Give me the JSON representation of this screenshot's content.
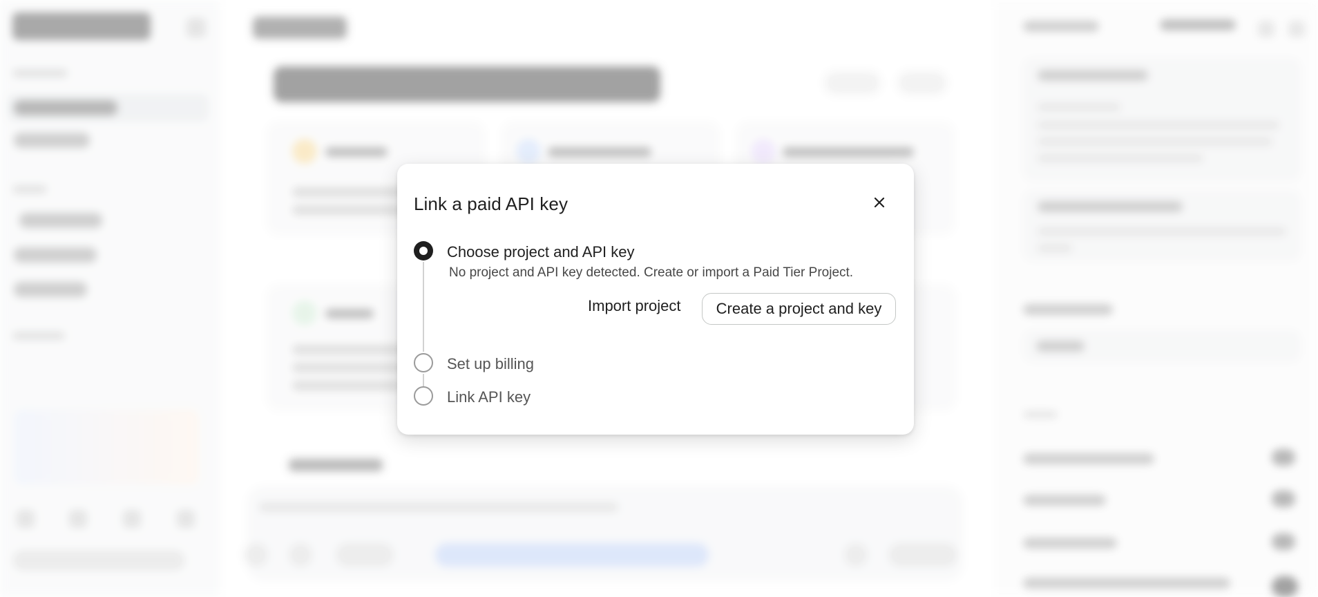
{
  "dialog": {
    "title": "Link a paid API key",
    "close_icon": "close-icon",
    "steps": [
      {
        "label": "Choose project and API key",
        "state": "active",
        "description": "No project and API key detected. Create or import a Paid Tier Project."
      },
      {
        "label": "Set up billing",
        "state": "inactive"
      },
      {
        "label": "Link API key",
        "state": "inactive"
      }
    ],
    "actions": {
      "import_label": "Import project",
      "create_label": "Create a project and key"
    }
  },
  "colors": {
    "dialog_background": "#ffffff",
    "text_primary": "#1f1f1f",
    "text_secondary": "#474747",
    "active_step": "#1f1f1f",
    "inactive_step_border": "#9a9a9a",
    "button_border": "#c4c7c5"
  }
}
